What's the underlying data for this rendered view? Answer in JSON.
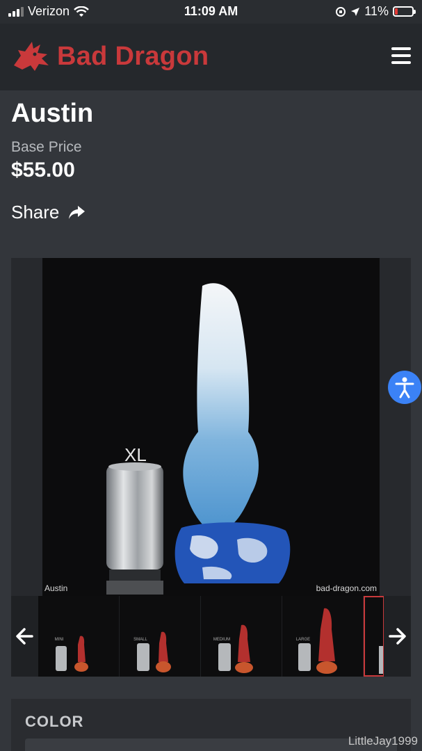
{
  "status_bar": {
    "carrier": "Verizon",
    "time": "11:09 AM",
    "battery": "11%",
    "battery_level": 0.11
  },
  "header": {
    "brand": "Bad Dragon",
    "brand_color": "#c9393b",
    "menu_icon": "hamburger-icon"
  },
  "product": {
    "title": "Austin",
    "price_label": "Base Price",
    "price": "$55.00",
    "share_label": "Share"
  },
  "gallery": {
    "size_label": "XL",
    "caption_left": "Austin",
    "caption_right": "bad-dragon.com",
    "thumbs": [
      {
        "label": "MINI"
      },
      {
        "label": "SMALL"
      },
      {
        "label": "MEDIUM"
      },
      {
        "label": "LARGE"
      }
    ]
  },
  "options": {
    "color_heading": "COLOR"
  },
  "watermark": "LittleJay1999"
}
